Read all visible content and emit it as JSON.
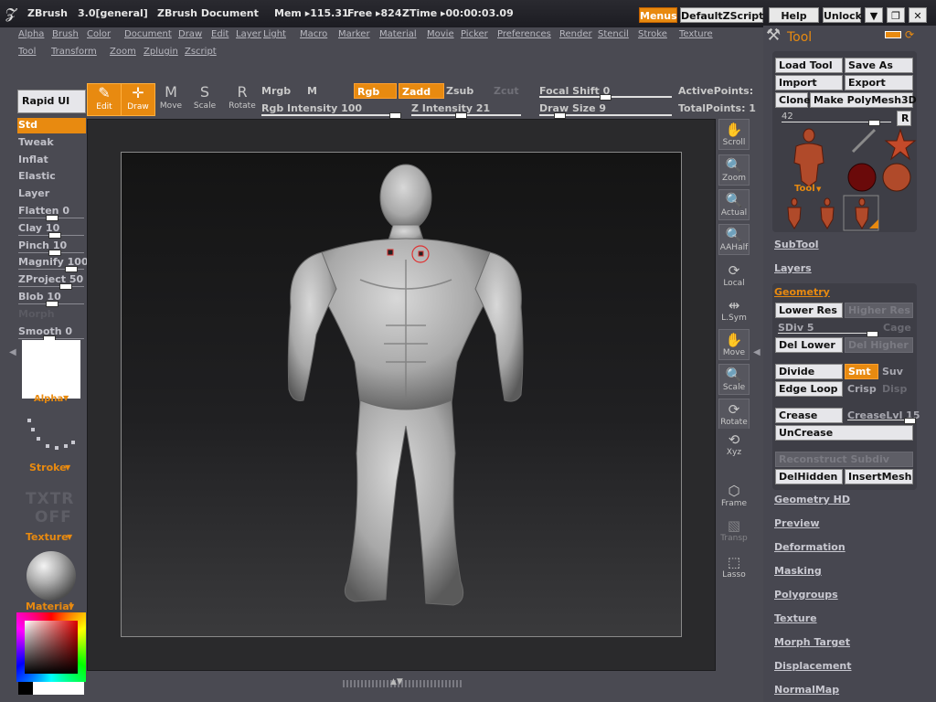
{
  "titlebar": {
    "app": "ZBrush",
    "version": "3.0[general]",
    "document": "ZBrush Document",
    "mem": "Mem ▸115.31",
    "free": "Free ▸824",
    "ztime": "ZTime ▸00:00:03.09",
    "buttons": [
      "Menus",
      "DefaultZScript",
      "Help",
      "Unlock"
    ],
    "win_controls": [
      "▼",
      "❐",
      "✕"
    ]
  },
  "menus": {
    "row1": [
      "Alpha",
      "Brush",
      "Color",
      "Document",
      "Draw",
      "Edit",
      "Layer",
      "Light",
      "Macro",
      "Marker",
      "Material",
      "Movie",
      "Picker",
      "Preferences",
      "Render",
      "Stencil",
      "Stroke",
      "Texture"
    ],
    "row2": [
      "Tool",
      "Transform",
      "Zoom",
      "Zplugin",
      "Zscript"
    ]
  },
  "toolbar": {
    "rapid": "Rapid UI",
    "tools": [
      {
        "label": "Edit",
        "icon": "✎",
        "on": true
      },
      {
        "label": "Draw",
        "icon": "✛",
        "on": true
      },
      {
        "label": "Move",
        "icon": "M",
        "on": false
      },
      {
        "label": "Scale",
        "icon": "S",
        "on": false
      },
      {
        "label": "Rotate",
        "icon": "R",
        "on": false
      }
    ],
    "mrgb": "Mrgb",
    "m": "M",
    "rgb": "Rgb",
    "zadd": "Zadd",
    "zsub": "Zsub",
    "zcut": "Zcut",
    "rgb_intensity": "Rgb Intensity 100",
    "z_intensity": "Z Intensity 21",
    "focal_shift": "Focal Shift 0",
    "draw_size": "Draw Size 9",
    "active_points": "ActivePoints:",
    "total_points": "TotalPoints: 1"
  },
  "left_panel": {
    "brushes": [
      {
        "label": "Std",
        "selected": true
      },
      {
        "label": "Tweak"
      },
      {
        "label": "Inflat"
      },
      {
        "label": "Elastic"
      },
      {
        "label": "Layer"
      },
      {
        "label": "Flatten 0",
        "slider": 0.5
      },
      {
        "label": "Clay 10",
        "slider": 0.55
      },
      {
        "label": "Pinch 10",
        "slider": 0.55
      },
      {
        "label": "Magnify 100",
        "slider": 0.85
      },
      {
        "label": "ZProject 50",
        "slider": 0.75
      },
      {
        "label": "Blob 10",
        "slider": 0.5
      },
      {
        "label": "Morph",
        "dim": true
      },
      {
        "label": "Smooth 0",
        "slider": 0.45
      }
    ],
    "alpha": "Alpha",
    "stroke": "Stroke",
    "txtr": "TXTR",
    "off": "OFF",
    "texture": "Texture",
    "material": "Material"
  },
  "canvas_tools": [
    {
      "label": "Scroll",
      "icon": "✋"
    },
    {
      "label": "Zoom",
      "icon": "🔍"
    },
    {
      "label": "Actual",
      "icon": "🔍"
    },
    {
      "label": "AAHalf",
      "icon": "🔍"
    },
    {
      "label": "Local",
      "icon": "⟳"
    },
    {
      "label": "L.Sym",
      "icon": "⇹"
    },
    {
      "label": "Move",
      "icon": "✋"
    },
    {
      "label": "Scale",
      "icon": "🔍"
    },
    {
      "label": "Rotate",
      "icon": "⟳"
    },
    {
      "label": "Xyz",
      "icon": "⟲"
    },
    {
      "label": "Frame",
      "icon": "⬡"
    },
    {
      "label": "Transp",
      "icon": "▧"
    },
    {
      "label": "Lasso",
      "icon": "⬚"
    }
  ],
  "right_panel": {
    "title": "Tool",
    "load_tool": "Load Tool",
    "save_as": "Save As",
    "import": "Import",
    "export": "Export",
    "clone": "Clone",
    "make_polymesh": "Make PolyMesh3D",
    "size_value": "42",
    "r": "R",
    "tool_thumb_label": "Tool",
    "subtool": "SubTool",
    "layers": "Layers",
    "geometry": "Geometry",
    "lower_res": "Lower Res",
    "higher_res": "Higher Res",
    "sdiv": "SDiv 5",
    "cage": "Cage",
    "del_lower": "Del Lower",
    "del_higher": "Del Higher",
    "divide": "Divide",
    "smt": "Smt",
    "suv": "Suv",
    "edge_loop": "Edge Loop",
    "crisp": "Crisp",
    "disp": "Disp",
    "crease": "Crease",
    "crease_lvl": "CreaseLvl 15",
    "uncrease": "UnCrease",
    "reconstruct": "Reconstruct Subdiv",
    "delhidden": "DelHidden",
    "insertmesh": "InsertMesh",
    "sections": [
      "Geometry HD",
      "Preview",
      "Deformation",
      "Masking",
      "Polygroups",
      "Texture",
      "Morph Target",
      "Displacement",
      "NormalMap"
    ]
  },
  "colors": {
    "accent": "#e88a10",
    "panel": "#4a4a52",
    "canvas": "#2a2a2c"
  }
}
